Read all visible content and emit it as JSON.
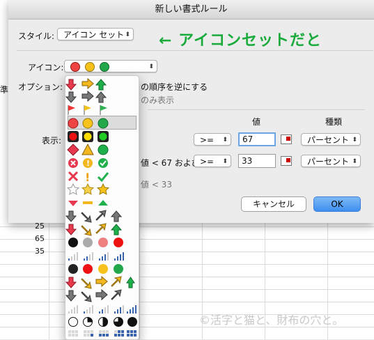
{
  "dialog": {
    "title": "新しい書式ルール",
    "style_label": "スタイル:",
    "style_value": "アイコン セット",
    "callout": "← アイコンセットだと",
    "icon_label": "アイコン:",
    "option_label": "オプション:",
    "option_partial_1": "の順序を逆にする",
    "option_partial_2": "のみ表示",
    "display_label": "表示:",
    "col_value": "値",
    "col_type": "種類",
    "row1_op": ">=",
    "row1_value": "67",
    "row1_type": "パーセント",
    "row2_partial": "値 < 67 および",
    "row2_op": ">=",
    "row2_value": "33",
    "row2_type": "パーセント",
    "row3_partial": "値 < 33",
    "cancel": "キャンセル",
    "ok": "OK"
  },
  "sheet": {
    "numbers": [
      "25",
      "65",
      "35"
    ],
    "partial_left": "準"
  },
  "icon_menu": {
    "selected_index": 3,
    "rows": [
      "3-arrows-colored",
      "3-arrows-gray",
      "3-flags",
      "3-traffic-lights-unrimmed",
      "3-traffic-lights-rimmed",
      "3-signs",
      "3-symbols-circled",
      "3-symbols-uncircled",
      "3-stars",
      "3-triangles",
      "4-arrows-gray",
      "4-arrows-colored",
      "red-to-black",
      "4-ratings",
      "4-traffic-lights",
      "5-arrows-colored",
      "5-arrows-gray",
      "5-ratings",
      "5-quarters",
      "5-boxes"
    ]
  },
  "watermark": "©活字と猫と、財布の穴と。"
}
